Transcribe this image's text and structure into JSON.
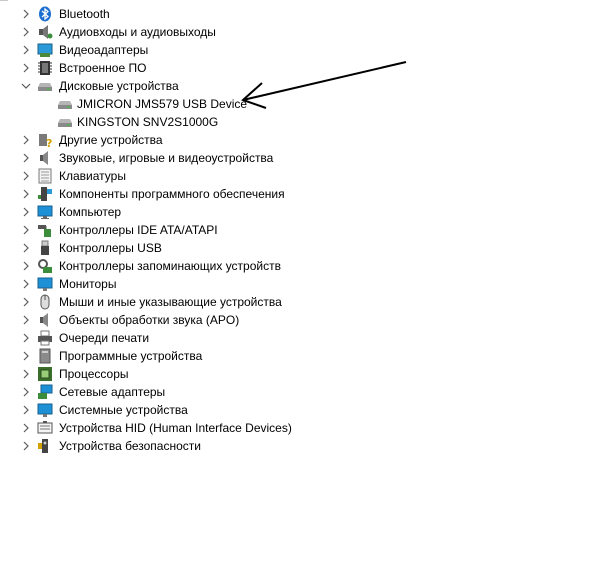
{
  "tree": {
    "categories": [
      {
        "label": "Bluetooth",
        "icon": "bluetooth-icon",
        "expanded": false
      },
      {
        "label": "Аудиовходы и аудиовыходы",
        "icon": "audio-io-icon",
        "expanded": false
      },
      {
        "label": "Видеоадаптеры",
        "icon": "display-adapter-icon",
        "expanded": false
      },
      {
        "label": "Встроенное ПО",
        "icon": "firmware-icon",
        "expanded": false
      },
      {
        "label": "Дисковые устройства",
        "icon": "disk-drive-icon",
        "expanded": true,
        "children": [
          {
            "label": "JMICRON JMS579 USB Device",
            "icon": "disk-drive-icon"
          },
          {
            "label": "KINGSTON SNV2S1000G",
            "icon": "disk-drive-icon"
          }
        ]
      },
      {
        "label": "Другие устройства",
        "icon": "unknown-device-icon",
        "expanded": false
      },
      {
        "label": "Звуковые, игровые и видеоустройства",
        "icon": "speaker-icon",
        "expanded": false
      },
      {
        "label": "Клавиатуры",
        "icon": "keyboard-icon",
        "expanded": false
      },
      {
        "label": "Компоненты программного обеспечения",
        "icon": "software-component-icon",
        "expanded": false
      },
      {
        "label": "Компьютер",
        "icon": "computer-icon",
        "expanded": false
      },
      {
        "label": "Контроллеры IDE ATA/ATAPI",
        "icon": "ide-controller-icon",
        "expanded": false
      },
      {
        "label": "Контроллеры USB",
        "icon": "usb-icon",
        "expanded": false
      },
      {
        "label": "Контроллеры запоминающих устройств",
        "icon": "storage-controller-icon",
        "expanded": false
      },
      {
        "label": "Мониторы",
        "icon": "monitor-icon",
        "expanded": false
      },
      {
        "label": "Мыши и иные указывающие устройства",
        "icon": "mouse-icon",
        "expanded": false
      },
      {
        "label": "Объекты обработки звука (APO)",
        "icon": "apo-icon",
        "expanded": false
      },
      {
        "label": "Очереди печати",
        "icon": "printer-icon",
        "expanded": false
      },
      {
        "label": "Программные устройства",
        "icon": "software-device-icon",
        "expanded": false
      },
      {
        "label": "Процессоры",
        "icon": "processor-icon",
        "expanded": false
      },
      {
        "label": "Сетевые адаптеры",
        "icon": "network-adapter-icon",
        "expanded": false
      },
      {
        "label": "Системные устройства",
        "icon": "system-device-icon",
        "expanded": false
      },
      {
        "label": "Устройства HID (Human Interface Devices)",
        "icon": "hid-icon",
        "expanded": false
      },
      {
        "label": "Устройства безопасности",
        "icon": "security-device-icon",
        "expanded": false
      }
    ]
  },
  "colors": {
    "chevron": "#5a5a5a",
    "monitor_blue": "#1e90d6",
    "drive_gray": "#8a8a8a",
    "arrow": "#000000"
  }
}
